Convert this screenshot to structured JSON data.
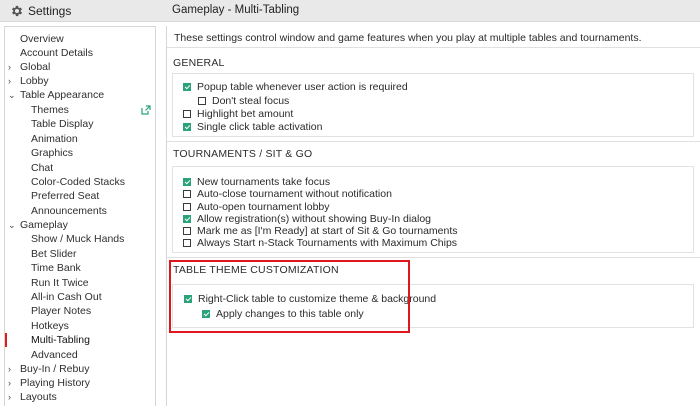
{
  "header": {
    "settings_label": "Settings",
    "page_title": "Gameplay - Multi-Tabling"
  },
  "sidebar": {
    "items": [
      {
        "label": "Overview",
        "level": 0,
        "chevron": ""
      },
      {
        "label": "Account Details",
        "level": 0,
        "chevron": ""
      },
      {
        "label": "Global",
        "level": 0,
        "chevron": "›"
      },
      {
        "label": "Lobby",
        "level": 0,
        "chevron": "›"
      },
      {
        "label": "Table Appearance",
        "level": 0,
        "chevron": "⌄"
      },
      {
        "label": "Themes",
        "level": 1,
        "chevron": ""
      },
      {
        "label": "Table Display",
        "level": 1,
        "chevron": ""
      },
      {
        "label": "Animation",
        "level": 1,
        "chevron": ""
      },
      {
        "label": "Graphics",
        "level": 1,
        "chevron": ""
      },
      {
        "label": "Chat",
        "level": 1,
        "chevron": ""
      },
      {
        "label": "Color-Coded Stacks",
        "level": 1,
        "chevron": ""
      },
      {
        "label": "Preferred Seat",
        "level": 1,
        "chevron": ""
      },
      {
        "label": "Announcements",
        "level": 1,
        "chevron": ""
      },
      {
        "label": "Gameplay",
        "level": 0,
        "chevron": "⌄"
      },
      {
        "label": "Show / Muck Hands",
        "level": 1,
        "chevron": ""
      },
      {
        "label": "Bet Slider",
        "level": 1,
        "chevron": ""
      },
      {
        "label": "Time Bank",
        "level": 1,
        "chevron": ""
      },
      {
        "label": "Run It Twice",
        "level": 1,
        "chevron": ""
      },
      {
        "label": "All-in Cash Out",
        "level": 1,
        "chevron": ""
      },
      {
        "label": "Player Notes",
        "level": 1,
        "chevron": ""
      },
      {
        "label": "Hotkeys",
        "level": 1,
        "chevron": ""
      },
      {
        "label": "Multi-Tabling",
        "level": 1,
        "chevron": "",
        "active": true
      },
      {
        "label": "Advanced",
        "level": 1,
        "chevron": ""
      },
      {
        "label": "Buy-In / Rebuy",
        "level": 0,
        "chevron": "›"
      },
      {
        "label": "Playing History",
        "level": 0,
        "chevron": "›"
      },
      {
        "label": "Layouts",
        "level": 0,
        "chevron": "›"
      }
    ]
  },
  "main": {
    "intro": "These settings control window and game features when you play at multiple tables and tournaments.",
    "general": {
      "title": "GENERAL",
      "options": [
        {
          "label": "Popup table whenever user action is required",
          "checked": true
        },
        {
          "label": "Don't steal focus",
          "checked": false
        },
        {
          "label": "Highlight bet amount",
          "checked": false
        },
        {
          "label": "Single click table activation",
          "checked": true
        }
      ]
    },
    "tournaments": {
      "title": "TOURNAMENTS / SIT & GO",
      "options": [
        {
          "label": "New tournaments take focus",
          "checked": true
        },
        {
          "label": "Auto-close tournament without notification",
          "checked": false
        },
        {
          "label": "Auto-open tournament lobby",
          "checked": false
        },
        {
          "label": "Allow registration(s) without showing Buy-In dialog",
          "checked": true
        },
        {
          "label": "Mark me as [I'm Ready] at start of Sit & Go tournaments",
          "checked": false
        },
        {
          "label": "Always Start n-Stack Tournaments with Maximum Chips",
          "checked": false
        }
      ]
    },
    "theme": {
      "title": "TABLE THEME CUSTOMIZATION",
      "options": [
        {
          "label": "Right-Click table to customize theme & background",
          "checked": true
        },
        {
          "label": "Apply changes to this table only",
          "checked": true
        }
      ]
    }
  },
  "colors": {
    "accent": "#2aa37b",
    "active_marker": "#e11b22",
    "highlight_border": "#e0161e"
  }
}
